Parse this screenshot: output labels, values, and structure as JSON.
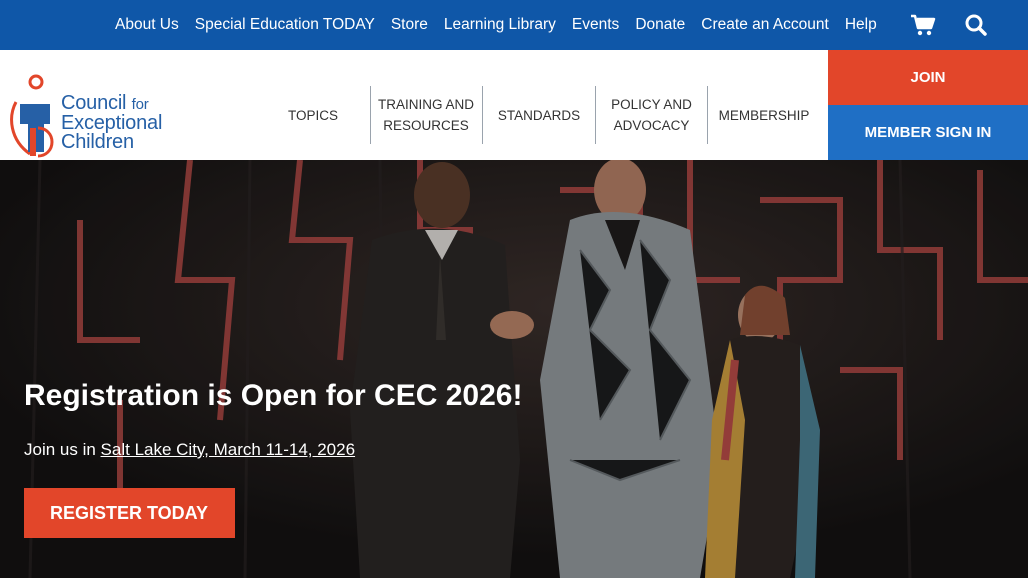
{
  "utility_nav": {
    "links": [
      "About Us",
      "Special Education TODAY",
      "Store",
      "Learning Library",
      "Events",
      "Donate",
      "Create an Account",
      "Help"
    ],
    "icons": [
      "cart-icon",
      "search-icon"
    ]
  },
  "logo": {
    "line1": "Council",
    "line1_suffix": "for",
    "line2": "Exceptional",
    "line3": "Children"
  },
  "main_nav": {
    "topics": "TOPICS",
    "training_1": "TRAINING AND",
    "training_2": "RESOURCES",
    "standards": "STANDARDS",
    "policy_1": "POLICY AND",
    "policy_2": "ADVOCACY",
    "membership": "MEMBERSHIP"
  },
  "account": {
    "join": "JOIN",
    "sign_in": "MEMBER SIGN IN"
  },
  "hero": {
    "title": "Registration is Open for CEC 2026!",
    "sub_prefix": "Join us in ",
    "sub_link": "Salt Lake City, March 11-14, 2026",
    "cta": "REGISTER TODAY"
  },
  "colors": {
    "topbar": "#0f57a8",
    "accent_orange": "#e2462a",
    "signin_blue": "#1f6fc5",
    "logo_blue": "#2660a6"
  }
}
